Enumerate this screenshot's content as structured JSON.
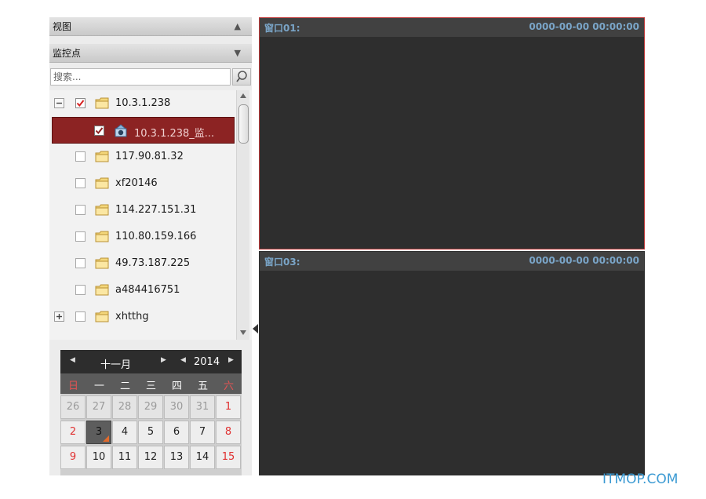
{
  "panels": {
    "view_label": "视图",
    "monitor_points_label": "监控点",
    "search_placeholder": "搜索..."
  },
  "tree": {
    "items": [
      {
        "label": "10.3.1.238",
        "checked": true,
        "expanded": true
      },
      {
        "label": "10.3.1.238_监...",
        "checked": true,
        "selected": true
      },
      {
        "label": "117.90.81.32",
        "checked": false
      },
      {
        "label": "xf20146",
        "checked": false
      },
      {
        "label": "114.227.151.31",
        "checked": false
      },
      {
        "label": "110.80.159.166",
        "checked": false
      },
      {
        "label": "49.73.187.225",
        "checked": false
      },
      {
        "label": "a484416751",
        "checked": false
      },
      {
        "label": "xhtthg",
        "checked": false,
        "expandable": true
      }
    ]
  },
  "calendar": {
    "month": "十一月",
    "year": "2014",
    "weekdays": [
      "日",
      "一",
      "二",
      "三",
      "四",
      "五",
      "六"
    ],
    "rows": [
      [
        "26",
        "27",
        "28",
        "29",
        "30",
        "31",
        "1"
      ],
      [
        "2",
        "3",
        "4",
        "5",
        "6",
        "7",
        "8"
      ],
      [
        "9",
        "10",
        "11",
        "12",
        "13",
        "14",
        "15"
      ]
    ],
    "today": "3"
  },
  "windows": [
    {
      "title": "窗口01:",
      "time": "0000-00-00 00:00:00"
    },
    {
      "title": "窗口03:",
      "time": "0000-00-00 00:00:00"
    }
  ],
  "watermark": "ITMOP.COM",
  "colors": {
    "selected_row": "#8c2323",
    "active_window_border": "#c23b3b",
    "video_bg": "#2e2e2e",
    "video_title": "#7aa5c8",
    "weekend": "#e03030",
    "watermark": "#3b9ad3"
  }
}
